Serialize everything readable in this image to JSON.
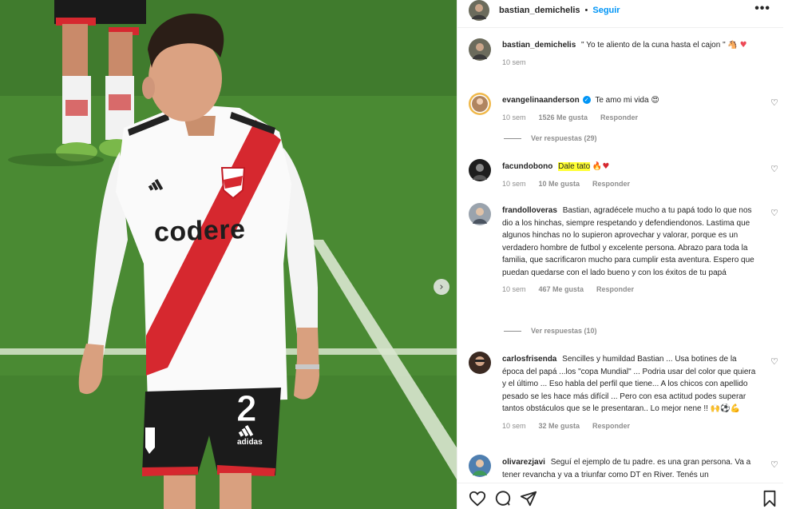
{
  "post": {
    "username": "bastian_demichelis",
    "separator": "•",
    "follow_label": "Seguir",
    "more_label": "•••",
    "next_label": "›"
  },
  "caption": {
    "username": "bastian_demichelis",
    "text": "\" Yo te aliento de la cuna hasta el cajon \"",
    "emoji": "🐴",
    "emoji2": "♥",
    "time": "10 sem"
  },
  "comments": [
    {
      "username": "evangelinaanderson",
      "verified": "✓",
      "text": "Te amo mi vida",
      "emoji": "😍",
      "time": "10 sem",
      "likes": "1526 Me gusta",
      "reply": "Responder",
      "view_replies": "Ver respuestas (29)"
    },
    {
      "username": "facundobono",
      "text": "Dale tato",
      "emoji": "🔥♥",
      "time": "10 sem",
      "likes": "10 Me gusta",
      "reply": "Responder"
    },
    {
      "username": "frandolloveras",
      "text": "Bastian, agradécele mucho a tu papá todo lo que nos dio a los hinchas, siempre respetando y defendiendonos. Lastima que algunos hinchas no lo supieron aprovechar y valorar, porque es un verdadero hombre de futbol y excelente persona. Abrazo para toda la familia, que sacrificaron mucho para cumplir esta aventura. Espero que puedan quedarse con el lado bueno y con los éxitos de tu papá",
      "time": "10 sem",
      "likes": "467 Me gusta",
      "reply": "Responder",
      "view_replies": "Ver respuestas (10)"
    },
    {
      "username": "carlosfrisenda",
      "text": "Sencilles y humildad Bastian ... Usa botines de la época del papá ...los \"copa Mundial\" ... Podria usar del color que quiera y el último ... Eso habla del perfil que tiene... A los chicos con apellido pesado se les hace más difícil ... Pero con esa actitud podes superar tantos obstáculos que se le presentaran.. Lo mejor nene !!",
      "emoji": "🙌⚽💪",
      "time": "10 sem",
      "likes": "32 Me gusta",
      "reply": "Responder"
    },
    {
      "username": "olivarezjavi",
      "text": "Seguí el ejemplo de tu padre. es una gran persona. Va a tener revancha y va a triunfar como DT en River. Tenés un"
    }
  ],
  "jersey": {
    "sponsor": "codere",
    "number": "2",
    "brand": "adidas"
  },
  "colors": {
    "accent": "#0095f6",
    "highlight": "#ffff33",
    "river_red": "#d6282f",
    "heart": "#ed4956"
  },
  "icons": [
    "more-icon",
    "heart-icon",
    "comment-icon",
    "share-icon",
    "bookmark-icon",
    "chevron-right-icon",
    "verified-icon"
  ]
}
